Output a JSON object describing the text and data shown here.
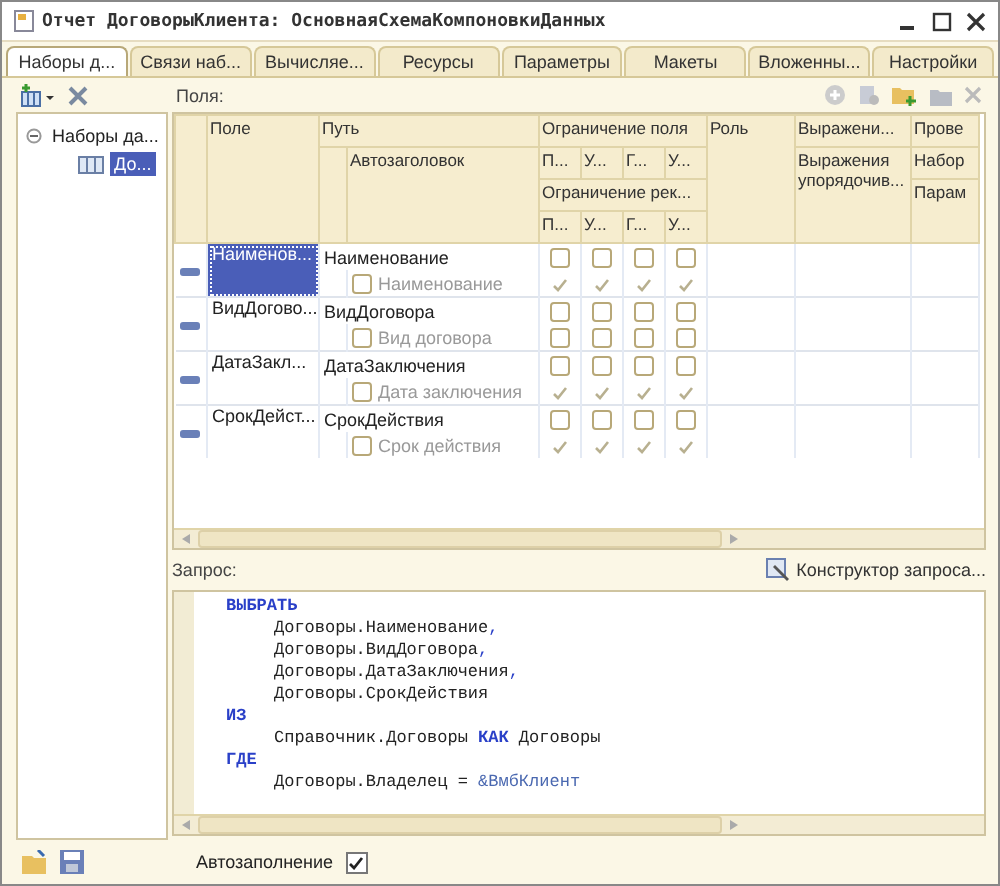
{
  "window": {
    "title": "Отчет ДоговорыКлиента: ОсновнаяСхемаКомпоновкиДанных"
  },
  "tabs": [
    {
      "label": "Наборы д...",
      "selected": true
    },
    {
      "label": "Связи наб...",
      "selected": false
    },
    {
      "label": "Вычисляе...",
      "selected": false
    },
    {
      "label": "Ресурсы",
      "selected": false
    },
    {
      "label": "Параметры",
      "selected": false
    },
    {
      "label": "Макеты",
      "selected": false
    },
    {
      "label": "Вложенны...",
      "selected": false
    },
    {
      "label": "Настройки",
      "selected": false
    }
  ],
  "tree": {
    "items": [
      {
        "label": "Наборы да...",
        "expanded": true,
        "selected": false,
        "children": [
          {
            "label": "До...",
            "selected": true
          }
        ]
      }
    ]
  },
  "fields_label": "Поля:",
  "grid": {
    "columns": {
      "field": "Поле",
      "path": "Путь",
      "title": "Автозаголовок",
      "field_restriction": "Ограничение поля",
      "field_restriction_cols": [
        "П...",
        "У...",
        "Г...",
        "У..."
      ],
      "attr_restriction": "Ограничение рек...",
      "attr_restriction_cols": [
        "П...",
        "У...",
        "Г...",
        "У..."
      ],
      "role": "Роль",
      "expressions": "Выражени...",
      "order_expressions": "Выражения упорядочив...",
      "column_8": "Прове",
      "column_8_sub1": "Набор",
      "column_8_sub2": "Парам"
    },
    "rows": [
      {
        "field": "Наименов...",
        "path": "Наименование",
        "title": "Наименование",
        "title_checked": false,
        "selected": true,
        "field_restriction": [
          false,
          false,
          false,
          false
        ],
        "attr_restriction": [
          true,
          true,
          true,
          true
        ]
      },
      {
        "field": "ВидДогово...",
        "path": "ВидДоговора",
        "title": "Вид договора",
        "title_checked": false,
        "selected": false,
        "field_restriction": [
          false,
          false,
          false,
          false
        ],
        "attr_restriction": [
          false,
          false,
          false,
          false
        ]
      },
      {
        "field": "ДатаЗакл...",
        "path": "ДатаЗаключения",
        "title": "Дата заключения",
        "title_checked": false,
        "selected": false,
        "field_restriction": [
          false,
          false,
          false,
          false
        ],
        "attr_restriction": [
          true,
          true,
          true,
          true
        ]
      },
      {
        "field": "СрокДейст...",
        "path": "СрокДействия",
        "title": "Срок действия",
        "title_checked": false,
        "selected": false,
        "field_restriction": [
          false,
          false,
          false,
          false
        ],
        "attr_restriction": [
          true,
          true,
          true,
          true
        ]
      }
    ]
  },
  "query_label": "Запрос:",
  "query_designer": "Конструктор запроса...",
  "query": [
    {
      "indent": false,
      "segments": [
        {
          "text": "ВЫБРАТЬ",
          "kind": "keyword"
        }
      ]
    },
    {
      "indent": true,
      "segments": [
        {
          "text": "Договоры.Наименование",
          "kind": "text"
        },
        {
          "text": ",",
          "kind": "punct"
        }
      ]
    },
    {
      "indent": true,
      "segments": [
        {
          "text": "Договоры.ВидДоговора",
          "kind": "text"
        },
        {
          "text": ",",
          "kind": "punct"
        }
      ]
    },
    {
      "indent": true,
      "segments": [
        {
          "text": "Договоры.ДатаЗаключения",
          "kind": "text"
        },
        {
          "text": ",",
          "kind": "punct"
        }
      ]
    },
    {
      "indent": true,
      "segments": [
        {
          "text": "Договоры.СрокДействия",
          "kind": "text"
        }
      ]
    },
    {
      "indent": false,
      "segments": [
        {
          "text": "ИЗ",
          "kind": "keyword"
        }
      ]
    },
    {
      "indent": true,
      "segments": [
        {
          "text": "Справочник.Договоры",
          "kind": "text"
        },
        {
          "text": " КАК",
          "kind": "keyword"
        },
        {
          "text": " Договоры",
          "kind": "text"
        }
      ]
    },
    {
      "indent": false,
      "segments": [
        {
          "text": "ГДЕ",
          "kind": "keyword"
        }
      ]
    },
    {
      "indent": true,
      "segments": [
        {
          "text": "Договоры.Владелец = ",
          "kind": "text"
        },
        {
          "text": "&ВмбКлиент",
          "kind": "param"
        }
      ]
    }
  ],
  "autofill": {
    "label": "Автозаполнение",
    "checked": true
  }
}
